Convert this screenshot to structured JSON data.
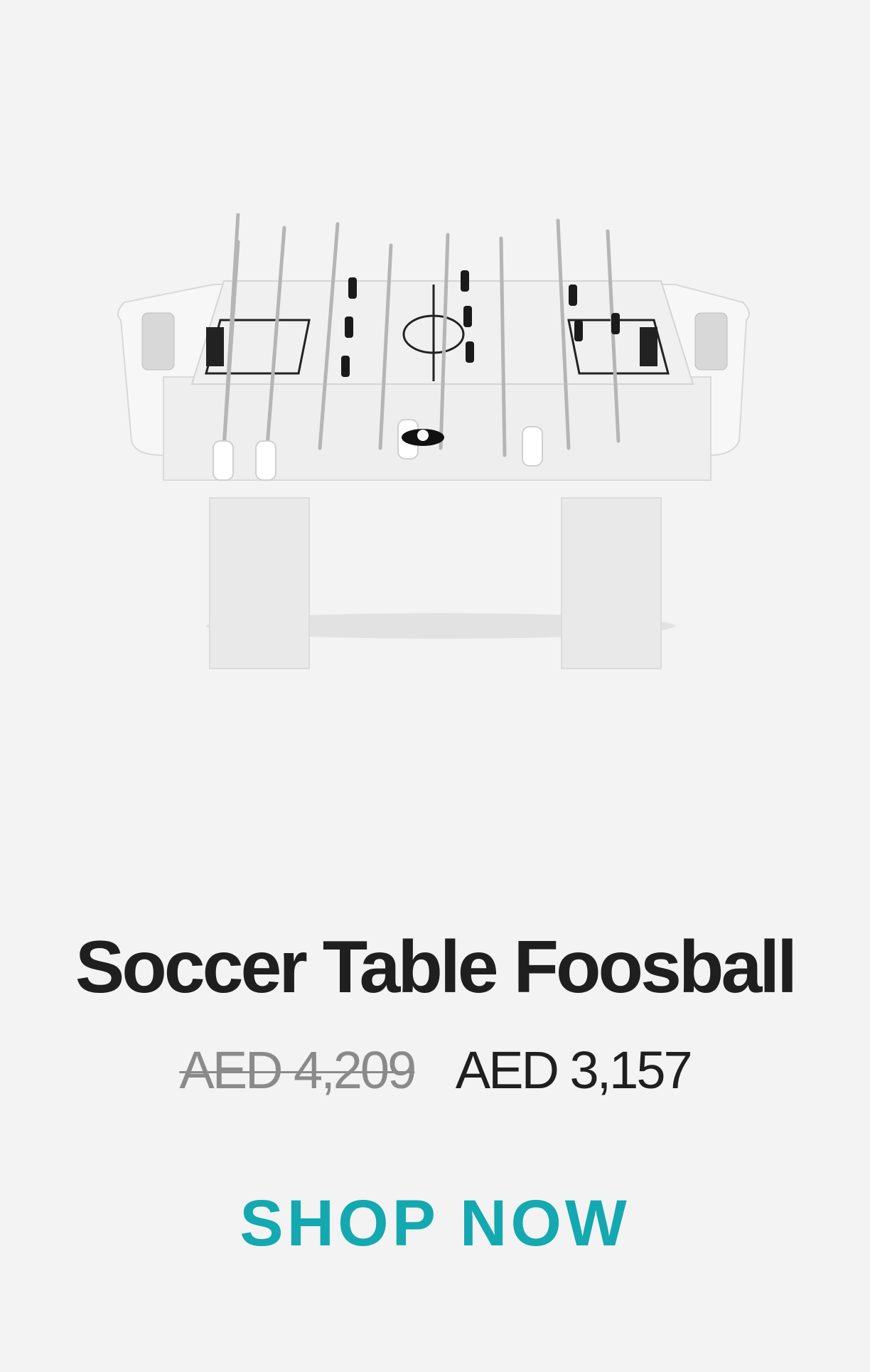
{
  "product": {
    "title": "Soccer Table Foosball",
    "original_price": "AED 4,209",
    "sale_price": "AED 3,157",
    "cta_label": "SHOP NOW",
    "image_name": "white-foosball-table-image"
  },
  "colors": {
    "background": "#f3f3f3",
    "title": "#1f1f1f",
    "old_price": "#8a8a8a",
    "cta": "#14a8b0"
  }
}
